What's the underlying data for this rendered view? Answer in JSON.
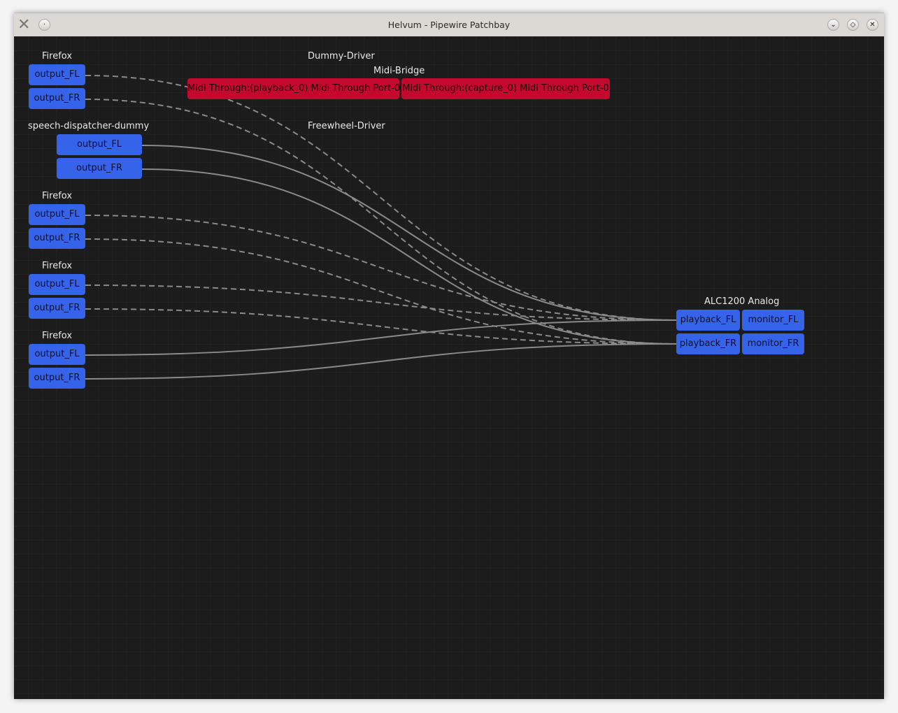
{
  "window": {
    "title": "Helvum - Pipewire Patchbay",
    "icon": "x-app-icon",
    "buttons": [
      "minimize",
      "maximize",
      "close"
    ]
  },
  "colors": {
    "port": "#3563ea",
    "midi_port": "#c5092e",
    "link": "#8a8a8a",
    "background": "#1c1c1c"
  },
  "nodes": [
    {
      "id": "ff1",
      "name": "Firefox",
      "ports": [
        "output_FL",
        "output_FR"
      ]
    },
    {
      "id": "sd",
      "name": "speech-dispatcher-dummy",
      "ports": [
        "output_FL",
        "output_FR"
      ]
    },
    {
      "id": "ff2",
      "name": "Firefox",
      "ports": [
        "output_FL",
        "output_FR"
      ]
    },
    {
      "id": "ff3",
      "name": "Firefox",
      "ports": [
        "output_FL",
        "output_FR"
      ]
    },
    {
      "id": "ff4",
      "name": "Firefox",
      "ports": [
        "output_FL",
        "output_FR"
      ]
    },
    {
      "id": "dummy",
      "name": "Dummy-Driver",
      "ports": []
    },
    {
      "id": "midi",
      "name": "Midi-Bridge",
      "ports": [
        "Midi Through:(playback_0) Midi Through Port-0",
        "Midi Through:(capture_0) Midi Through Port-0"
      ]
    },
    {
      "id": "fw",
      "name": "Freewheel-Driver",
      "ports": []
    },
    {
      "id": "alc",
      "name": "ALC1200 Analog",
      "ports": [
        "playback_FL",
        "monitor_FL",
        "playback_FR",
        "monitor_FR"
      ]
    }
  ],
  "links": [
    {
      "from": "ff1.output_FL",
      "to": "alc.playback_FL",
      "active": false
    },
    {
      "from": "ff1.output_FR",
      "to": "alc.playback_FR",
      "active": false
    },
    {
      "from": "sd.output_FL",
      "to": "alc.playback_FL",
      "active": true
    },
    {
      "from": "sd.output_FR",
      "to": "alc.playback_FR",
      "active": true
    },
    {
      "from": "ff2.output_FL",
      "to": "alc.playback_FL",
      "active": false
    },
    {
      "from": "ff2.output_FR",
      "to": "alc.playback_FR",
      "active": false
    },
    {
      "from": "ff3.output_FL",
      "to": "alc.playback_FL",
      "active": false
    },
    {
      "from": "ff3.output_FR",
      "to": "alc.playback_FR",
      "active": false
    },
    {
      "from": "ff4.output_FL",
      "to": "alc.playback_FL",
      "active": true
    },
    {
      "from": "ff4.output_FR",
      "to": "alc.playback_FR",
      "active": true
    }
  ]
}
